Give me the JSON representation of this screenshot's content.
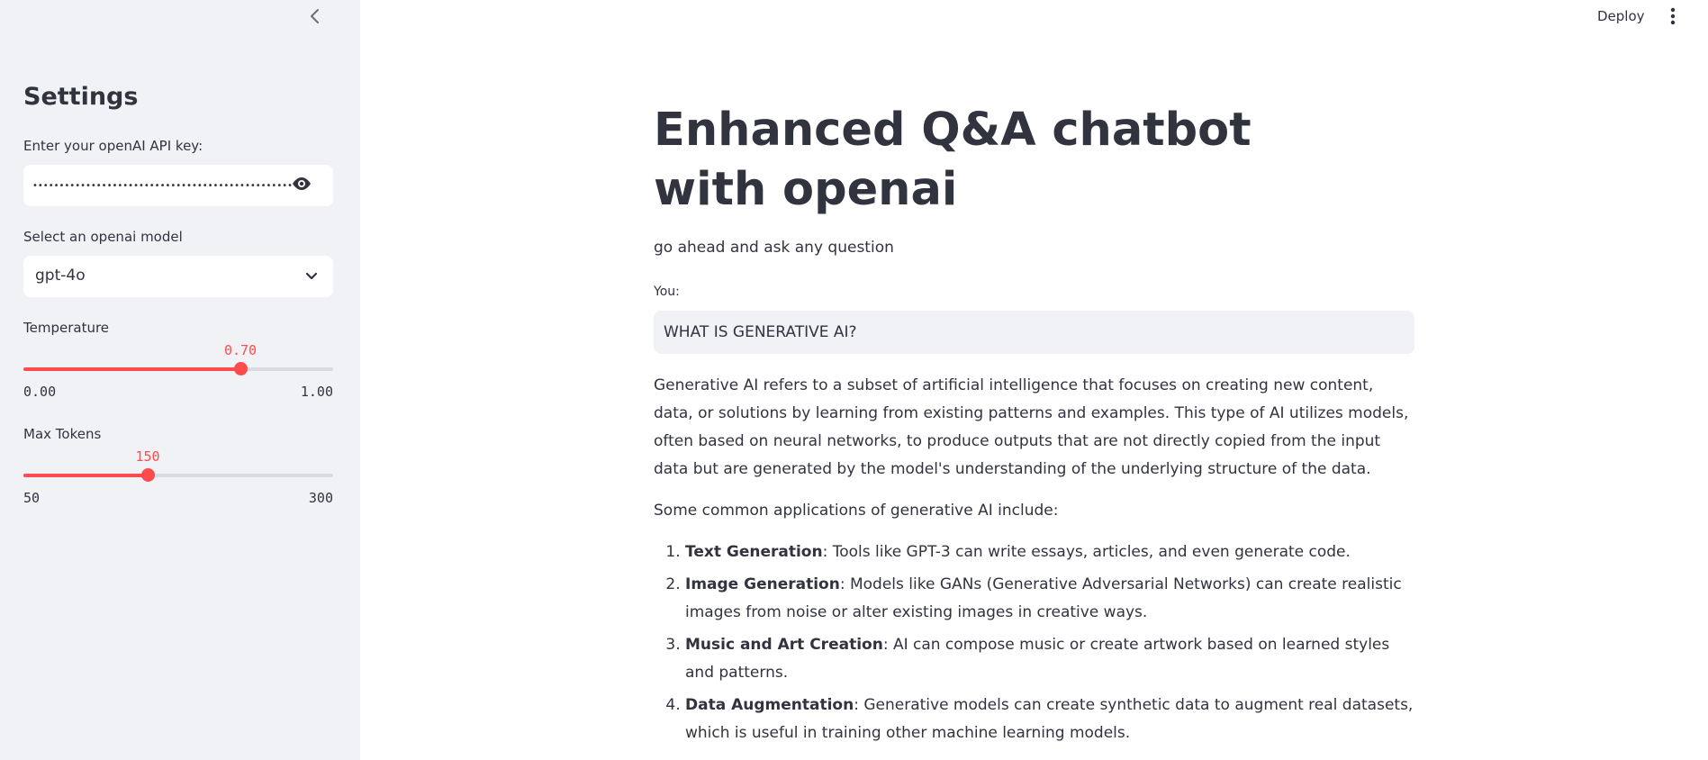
{
  "sidebar": {
    "title": "Settings",
    "api_key_label": "Enter your openAI API key:",
    "api_key_value": "•••••••••••••••••••••••••••••••••••••••••••••••••",
    "model_label": "Select an openai model",
    "model_value": "gpt-4o",
    "temperature": {
      "label": "Temperature",
      "value": 0.7,
      "value_text": "0.70",
      "min": "0.00",
      "max": "1.00",
      "fraction": 0.7
    },
    "max_tokens": {
      "label": "Max Tokens",
      "value": 150,
      "value_text": "150",
      "min": "50",
      "max": "300",
      "fraction": 0.4
    }
  },
  "topbar": {
    "deploy_label": "Deploy"
  },
  "main": {
    "title": "Enhanced Q&A chatbot with openai",
    "subtitle": "go ahead and ask any question",
    "input_label": "You:",
    "input_value": "WHAT IS GENERATIVE AI?",
    "answer": {
      "paragraph_1": "Generative AI refers to a subset of artificial intelligence that focuses on creating new content, data, or solutions by learning from existing patterns and examples. This type of AI utilizes models, often based on neural networks, to produce outputs that are not directly copied from the input data but are generated by the model's understanding of the underlying structure of the data.",
      "paragraph_2": "Some common applications of generative AI include:",
      "items": [
        {
          "term": "Text Generation",
          "text": ": Tools like GPT-3 can write essays, articles, and even generate code."
        },
        {
          "term": "Image Generation",
          "text": ": Models like GANs (Generative Adversarial Networks) can create realistic images from noise or alter existing images in creative ways."
        },
        {
          "term": "Music and Art Creation",
          "text": ": AI can compose music or create artwork based on learned styles and patterns."
        },
        {
          "term": "Data Augmentation",
          "text": ": Generative models can create synthetic data to augment real datasets, which is useful in training other machine learning models."
        }
      ]
    }
  },
  "colors": {
    "accent": "#ff4b4b",
    "sidebar_bg": "#f0f2f6",
    "text": "#31333f",
    "track": "#d6dae3"
  },
  "icons": {
    "collapse": "chevron-left-icon",
    "show_password": "eye-icon",
    "dropdown": "chevron-down-icon",
    "menu": "vertical-dots-icon"
  }
}
